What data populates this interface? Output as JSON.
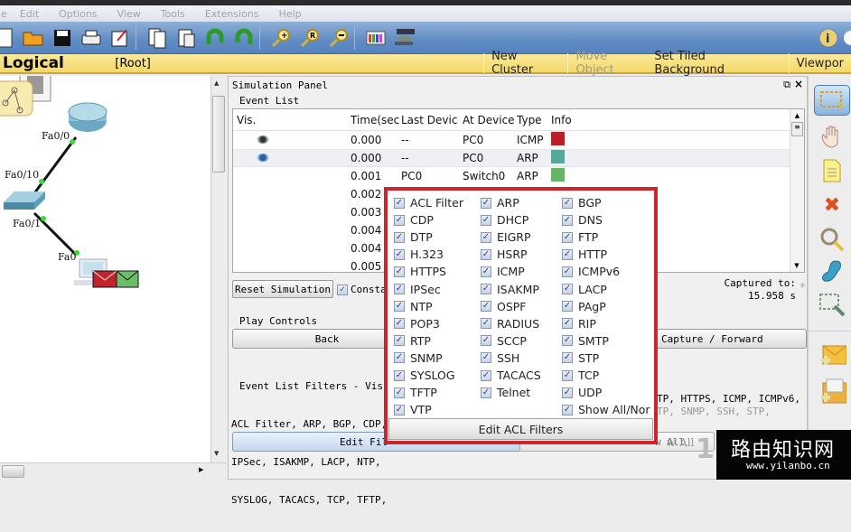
{
  "menu": [
    "le",
    "Edit",
    "Options",
    "View",
    "Tools",
    "Extensions",
    "Help"
  ],
  "toolbar": {
    "icons": [
      "new-file-icon",
      "open-folder-icon",
      "save-icon",
      "print-icon",
      "activity-wizard-icon",
      "copy-icon",
      "paste-icon",
      "undo-icon",
      "redo-icon",
      "zoom-in-icon",
      "zoom-reset-icon",
      "zoom-out-icon",
      "palette-icon",
      "custom-device-icon"
    ],
    "info_icon": "info-icon"
  },
  "workspace": {
    "title": "Logical",
    "root": "[Root]",
    "buttons": [
      {
        "label": "New Cluster",
        "enabled": true
      },
      {
        "label": "Move Object",
        "enabled": false
      },
      {
        "label": "Set Tiled Background",
        "enabled": true
      },
      {
        "label": "Viewpor",
        "enabled": true
      }
    ]
  },
  "topology": {
    "labels": {
      "router_port": "Fa0/0",
      "switch_uplink": "Fa0/10",
      "switch_port": "Fa0/1",
      "pc_port": "Fa0"
    },
    "link_color": "#111111",
    "port_status_color": "#33dd33"
  },
  "simulation": {
    "panel_title": "Simulation Panel",
    "event_list_label": "Event List",
    "columns": [
      "Vis.",
      "Time(sec",
      "Last Devic",
      "At Device",
      "Type",
      "Info"
    ],
    "events": [
      {
        "vis": "eye",
        "time": "0.000",
        "last": "--",
        "at": "PC0",
        "type": "ICMP",
        "color": "#b82025"
      },
      {
        "vis": "eye-blue",
        "time": "0.000",
        "last": "--",
        "at": "PC0",
        "type": "ARP",
        "color": "#55a89a",
        "selected": true
      },
      {
        "vis": "",
        "time": "0.001",
        "last": "PC0",
        "at": "Switch0",
        "type": "ARP",
        "color": "#68b466"
      },
      {
        "vis": "",
        "time": "0.002",
        "last": "",
        "at": "",
        "type": "",
        "color": ""
      },
      {
        "vis": "",
        "time": "0.003",
        "last": "",
        "at": "",
        "type": "",
        "color": ""
      },
      {
        "vis": "",
        "time": "0.004",
        "last": "",
        "at": "",
        "type": "",
        "color": ""
      },
      {
        "vis": "",
        "time": "0.004",
        "last": "",
        "at": "",
        "type": "",
        "color": ""
      },
      {
        "vis": "",
        "time": "0.005",
        "last": "",
        "at": "",
        "type": "",
        "color": ""
      }
    ],
    "reset_label": "Reset Simulation",
    "constant_label": "Consta",
    "constant_checked": true,
    "captured_label": "Captured to:",
    "captured_value": "15.958 s",
    "play_controls_label": "Play Controls",
    "back_label": "Back",
    "forward_label": "Capture / Forward",
    "filters_label": "Event List Filters - Vis",
    "filters_lines": [
      "ACL Filter, ARP, BGP, CDP,",
      "IPSec, ISAKMP, LACP, NTP,",
      "SYSLOG, TACACS, TCP, TFTP,"
    ],
    "filters_lines_right": [
      "TP, HTTPS, ICMP, ICMPv6,",
      "TP, SNMP, SSH, STP,"
    ],
    "edit_filters_label": "Edit Fil",
    "show_all_label": "w All"
  },
  "filter_popup": {
    "columns": [
      [
        "ACL Filter",
        "CDP",
        "DTP",
        "H.323",
        "HTTPS",
        "IPSec",
        "NTP",
        "POP3",
        "RTP",
        "SNMP",
        "SYSLOG",
        "TFTP",
        "VTP"
      ],
      [
        "ARP",
        "DHCP",
        "EIGRP",
        "HSRP",
        "ICMP",
        "ISAKMP",
        "OSPF",
        "RADIUS",
        "SCCP",
        "SSH",
        "TACACS",
        "Telnet"
      ],
      [
        "BGP",
        "DNS",
        "FTP",
        "HTTP",
        "ICMPv6",
        "LACP",
        "PAgP",
        "RIP",
        "SMTP",
        "STP",
        "TCP",
        "UDP",
        "Show All/Nor"
      ]
    ],
    "all_checked": true,
    "button_label": "Edit ACL Filters",
    "highlight_color": "#d0232b"
  },
  "right_tools": [
    "select-icon",
    "hand-icon",
    "note-icon",
    "delete-icon",
    "inspect-icon",
    "draw-shape-icon",
    "resize-icon",
    "add-simple-pdu-icon",
    "add-complex-pdu-icon"
  ],
  "watermark": {
    "title": "路由知识网",
    "url": "www.yilanbo.cn",
    "ghost": "1"
  }
}
